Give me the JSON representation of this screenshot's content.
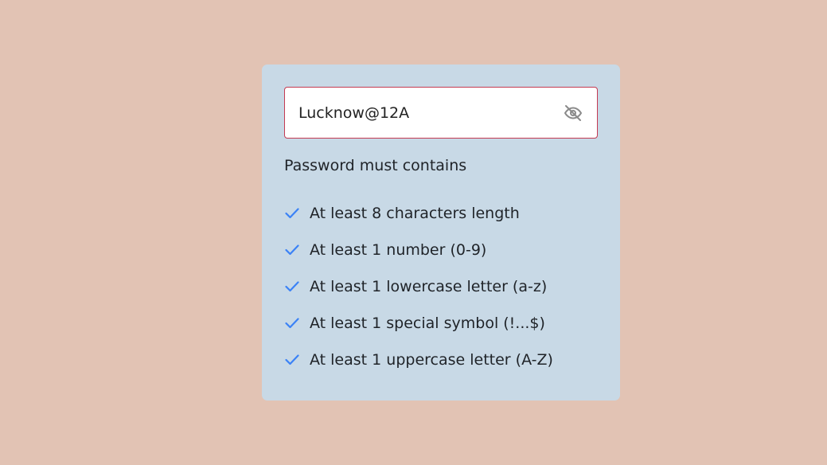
{
  "password": {
    "value": "Lucknow@12A",
    "toggle_icon": "eye-slash-icon"
  },
  "requirements": {
    "heading": "Password must contains",
    "check_icon": "check-icon",
    "check_color": "#3b82f6",
    "items": [
      {
        "label": "At least 8 characters length",
        "met": true
      },
      {
        "label": "At least 1 number (0-9)",
        "met": true
      },
      {
        "label": "At least 1 lowercase letter (a-z)",
        "met": true
      },
      {
        "label": "At least 1 special symbol (!...$)",
        "met": true
      },
      {
        "label": "At least 1 uppercase letter (A-Z)",
        "met": true
      }
    ]
  },
  "colors": {
    "page_background": "#e2c3b4",
    "card_background": "#c8d9e6",
    "input_border": "#c43a52"
  }
}
